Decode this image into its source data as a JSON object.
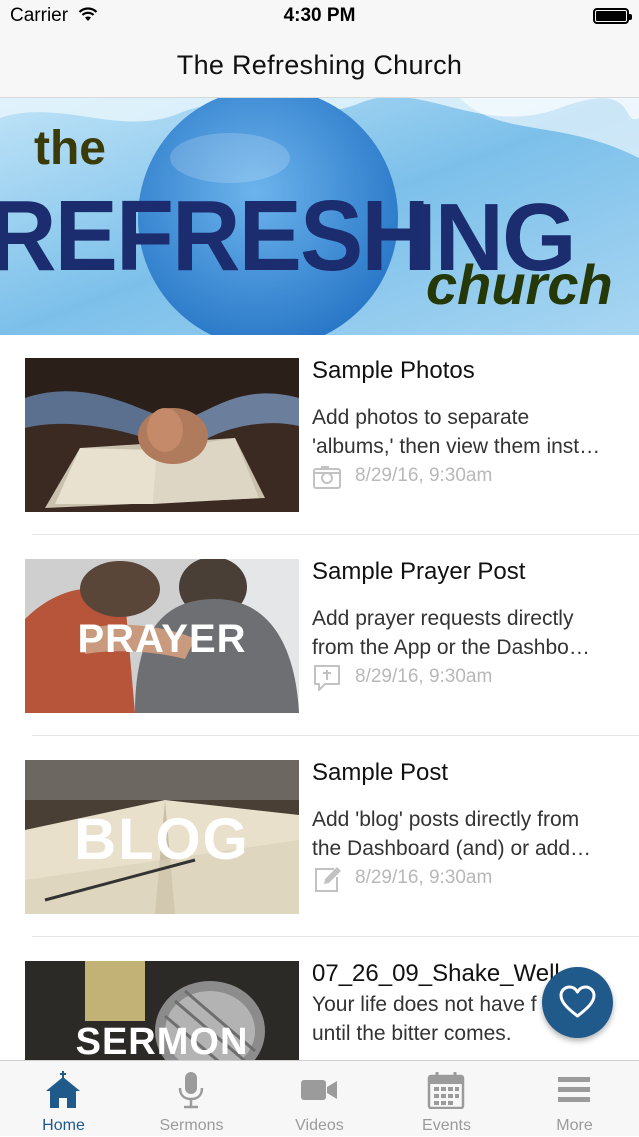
{
  "status_bar": {
    "carrier": "Carrier",
    "time": "4:30 PM"
  },
  "nav": {
    "title": "The Refreshing Church"
  },
  "banner": {
    "word_the": "the",
    "word_refresh": "REFRESH",
    "word_ing": "ING",
    "word_church": "church"
  },
  "feed": [
    {
      "title": "Sample Photos",
      "desc_line1": "Add photos to separate",
      "desc_line2": "'albums,' then view them inst…",
      "date": "8/29/16, 9:30am",
      "icon": "camera-icon",
      "thumb_text": ""
    },
    {
      "title": "Sample Prayer Post",
      "desc_line1": "Add prayer requests directly",
      "desc_line2": "from the App or the Dashbo…",
      "date": "8/29/16, 9:30am",
      "icon": "prayer-bubble-icon",
      "thumb_text": "PRAYER"
    },
    {
      "title": "Sample Post",
      "desc_line1": "Add 'blog' posts directly from",
      "desc_line2": "the Dashboard (and) or add…",
      "date": "8/29/16, 9:30am",
      "icon": "edit-icon",
      "thumb_text": "BLOG"
    },
    {
      "title": "07_26_09_Shake_Well",
      "desc_line1": "Your life does not have f",
      "desc_line2": "until the bitter comes.",
      "date": "",
      "icon": "",
      "thumb_text": "SERMON"
    }
  ],
  "tabs": [
    {
      "label": "Home",
      "icon": "home-icon",
      "active": true
    },
    {
      "label": "Sermons",
      "icon": "microphone-icon",
      "active": false
    },
    {
      "label": "Videos",
      "icon": "video-camera-icon",
      "active": false
    },
    {
      "label": "Events",
      "icon": "calendar-icon",
      "active": false
    },
    {
      "label": "More",
      "icon": "menu-icon",
      "active": false
    }
  ],
  "colors": {
    "accent": "#1f5a8a",
    "inactive": "#9b9b9b",
    "meta": "#b8b8b8"
  }
}
